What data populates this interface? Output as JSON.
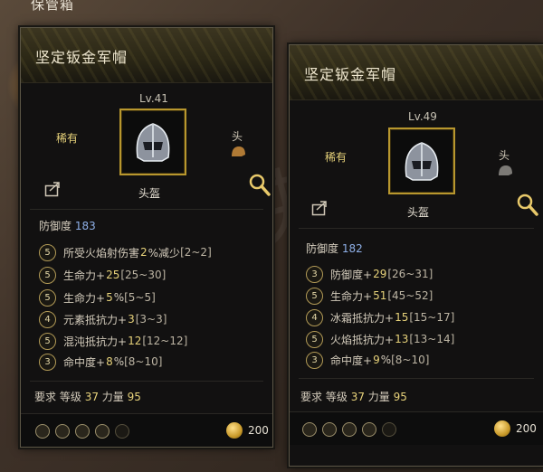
{
  "background": {
    "top_label": "保管箱"
  },
  "left_card": {
    "title": "坚定钣金军帽",
    "level": "Lv.41",
    "rarity": "稀有",
    "slot": "头",
    "item_name": "头盔",
    "defense_label": "防御度",
    "defense_value": "183",
    "stats": [
      {
        "tier": "5",
        "text": "所受火焰射伤害",
        "value": "2",
        "unit": "%减少",
        "range": "[2~2]"
      },
      {
        "tier": "5",
        "text": "生命力+",
        "value": "25",
        "unit": "",
        "range": "[25~30]"
      },
      {
        "tier": "5",
        "text": "生命力+",
        "value": "5",
        "unit": "%",
        "range": "[5~5]"
      },
      {
        "tier": "4",
        "text": "元素抵抗力+",
        "value": "3",
        "unit": "",
        "range": "[3~3]"
      },
      {
        "tier": "5",
        "text": "混沌抵抗力+",
        "value": "12",
        "unit": "",
        "range": "[12~12]"
      },
      {
        "tier": "3",
        "text": "命中度+",
        "value": "8",
        "unit": "%",
        "range": "[8~10]"
      }
    ],
    "requirements": {
      "label": "要求",
      "level_label": "等级",
      "level": "37",
      "strength_label": "力量",
      "strength": "95"
    },
    "price": "200"
  },
  "right_card": {
    "title": "坚定钣金军帽",
    "level": "Lv.49",
    "rarity": "稀有",
    "slot": "头",
    "item_name": "头盔",
    "defense_label": "防御度",
    "defense_value": "182",
    "stats": [
      {
        "tier": "3",
        "text": "防御度+",
        "value": "29",
        "unit": "",
        "range": "[26~31]"
      },
      {
        "tier": "5",
        "text": "生命力+",
        "value": "51",
        "unit": "",
        "range": "[45~52]"
      },
      {
        "tier": "4",
        "text": "冰霜抵抗力+",
        "value": "15",
        "unit": "",
        "range": "[15~17]"
      },
      {
        "tier": "5",
        "text": "火焰抵抗力+",
        "value": "13",
        "unit": "",
        "range": "[13~14]"
      },
      {
        "tier": "3",
        "text": "命中度+",
        "value": "9",
        "unit": "%",
        "range": "[8~10]"
      }
    ],
    "requirements": {
      "label": "要求",
      "level_label": "等级",
      "level": "37",
      "strength_label": "力量",
      "strength": "95"
    },
    "price": "200"
  },
  "colors": {
    "rarity": "#e7d27a",
    "defense_number": "#8fb0e8",
    "frame_gold": "#b8972e"
  }
}
